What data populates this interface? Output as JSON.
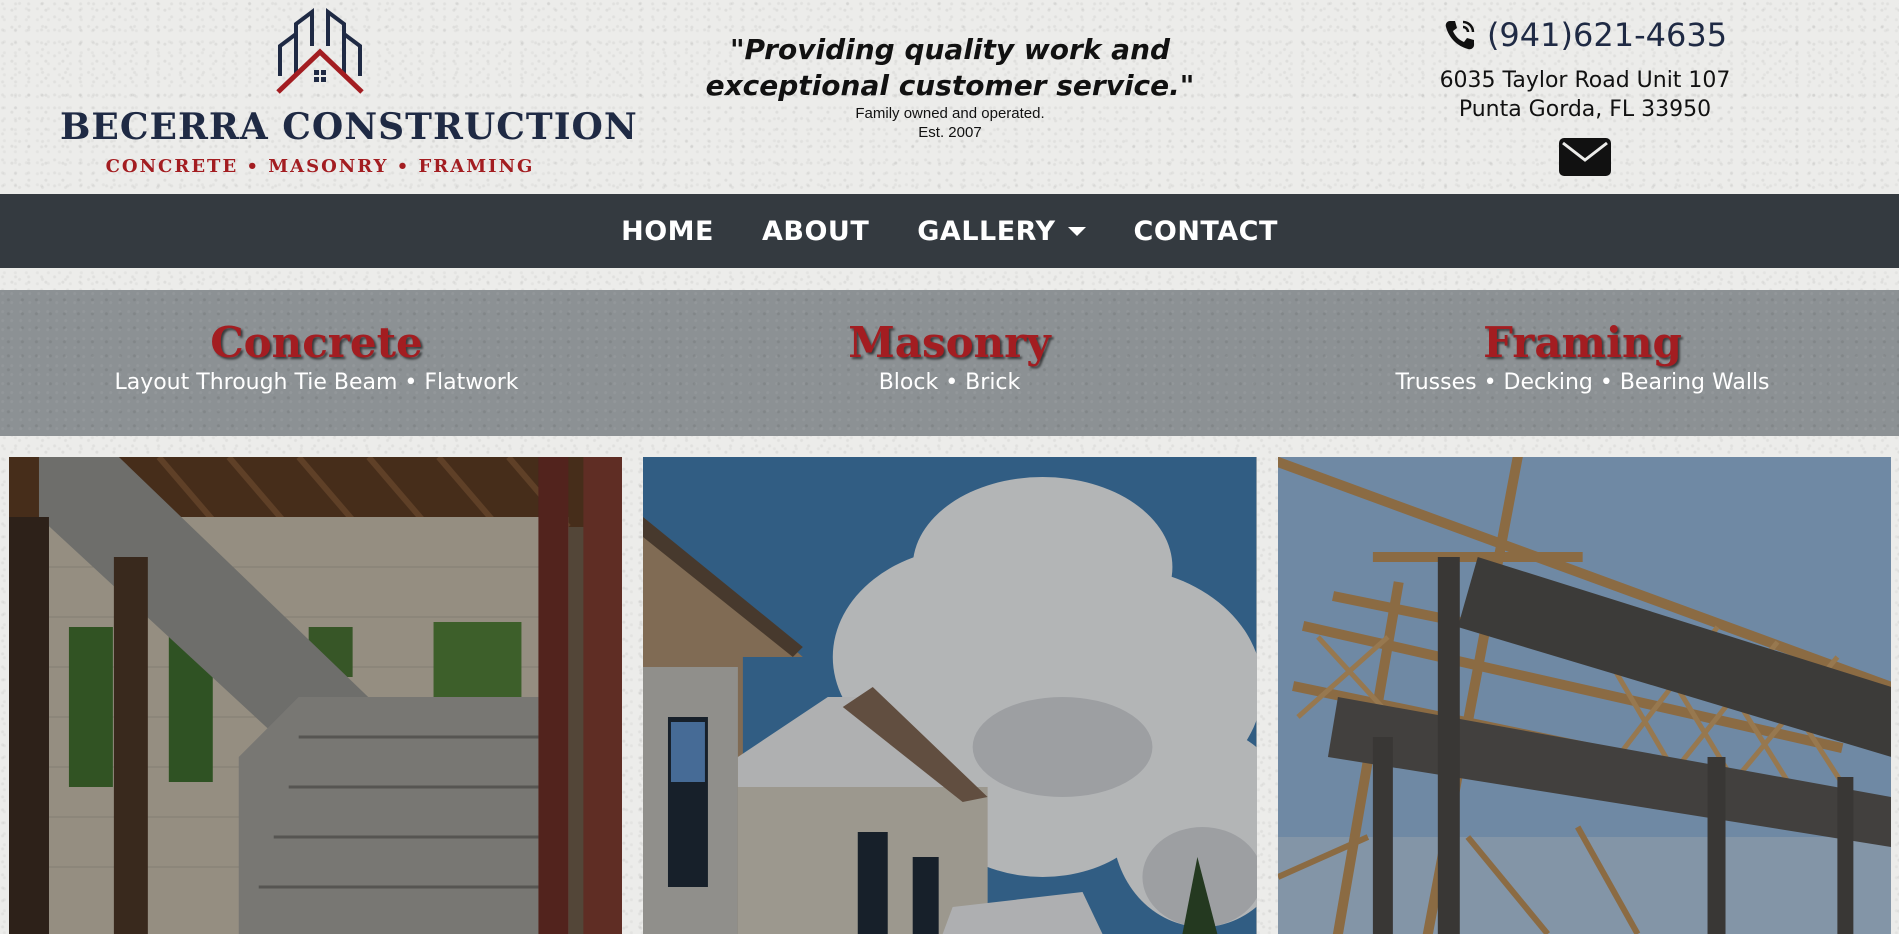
{
  "brand": {
    "name": "BECERRA CONSTRUCTION",
    "tagline": "CONCRETE • MASONRY • FRAMING",
    "icon": "house-building-logo-icon"
  },
  "slogan": {
    "quote": "\"Providing quality work and exceptional customer service.\"",
    "line1": "Family owned and operated.",
    "line2": "Est. 2007"
  },
  "contact": {
    "phone": "(941)621-4635",
    "address_line1": "6035 Taylor Road Unit 107",
    "address_line2": "Punta Gorda, FL 33950",
    "phone_icon": "phone-icon",
    "email_icon": "envelope-icon"
  },
  "nav": {
    "home": "HOME",
    "about": "ABOUT",
    "gallery": "GALLERY",
    "contact": "CONTACT"
  },
  "services": [
    {
      "title": "Concrete",
      "subtitle": "Layout Through Tie Beam • Flatwork"
    },
    {
      "title": "Masonry",
      "subtitle": "Block • Brick"
    },
    {
      "title": "Framing",
      "subtitle": "Trusses • Decking • Bearing Walls"
    }
  ],
  "colors": {
    "navy": "#1f2a44",
    "red": "#a31d21",
    "nav_bg": "#343a40",
    "band_bg": "#8c9194"
  }
}
